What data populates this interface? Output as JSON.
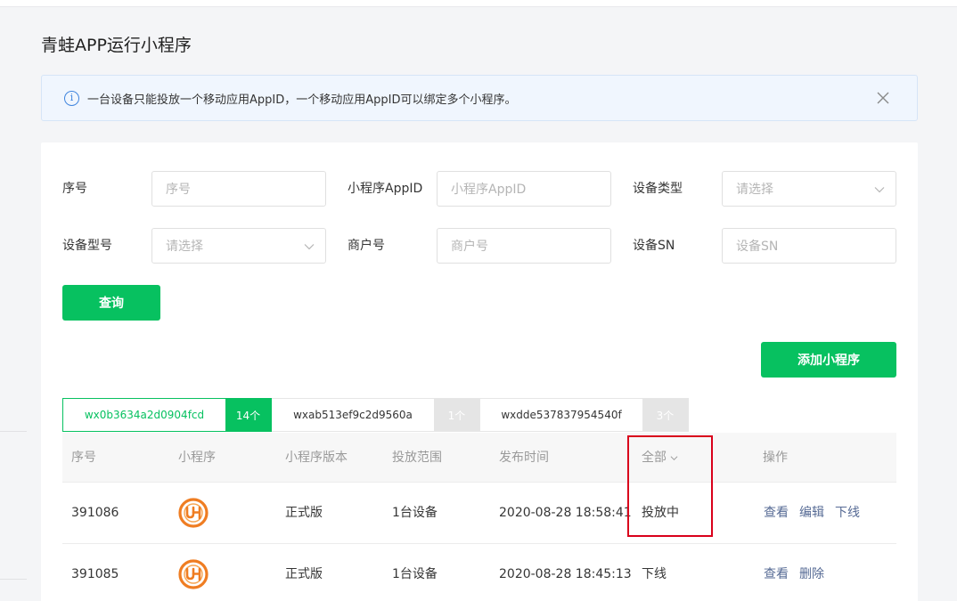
{
  "page": {
    "title": "青蛙APP运行小程序"
  },
  "notice": {
    "text": "一台设备只能投放一个移动应用AppID，一个移动应用AppID可以绑定多个小程序。"
  },
  "filters": {
    "serial": {
      "label": "序号",
      "placeholder": "序号"
    },
    "appid": {
      "label": "小程序AppID",
      "placeholder": "小程序AppID"
    },
    "device_type": {
      "label": "设备类型",
      "placeholder": "请选择"
    },
    "device_model": {
      "label": "设备型号",
      "placeholder": "请选择"
    },
    "merchant": {
      "label": "商户号",
      "placeholder": "商户号"
    },
    "sn": {
      "label": "设备SN",
      "placeholder": "设备SN"
    },
    "query_label": "查询"
  },
  "add_button_label": "添加小程序",
  "tabs": [
    {
      "name": "wx0b3634a2d0904fcd",
      "count": "14个",
      "active": true
    },
    {
      "name": "wxab513ef9c2d9560a",
      "count": "1个",
      "active": false
    },
    {
      "name": "wxdde537837954540f",
      "count": "3个",
      "active": false
    }
  ],
  "table": {
    "headers": {
      "serial": "序号",
      "app": "小程序",
      "version": "小程序版本",
      "scope": "投放范围",
      "time": "发布时间",
      "status": "全部",
      "ops": "操作"
    },
    "rows": [
      {
        "serial": "391086",
        "version": "正式版",
        "scope": "1台设备",
        "time": "2020-08-28 18:58:41",
        "status": "投放中",
        "ops": [
          "查看",
          "编辑",
          "下线"
        ]
      },
      {
        "serial": "391085",
        "version": "正式版",
        "scope": "1台设备",
        "time": "2020-08-28 18:45:13",
        "status": "下线",
        "ops": [
          "查看",
          "删除"
        ]
      }
    ]
  },
  "colors": {
    "brand_green": "#07c160",
    "link": "#576b95",
    "info_blue": "#3f85de",
    "highlight_red": "#d9001b"
  },
  "icons": {
    "notice": "info-icon",
    "close": "close-icon",
    "select": "chevron-down-icon",
    "app_logo": "uh-logo-icon"
  }
}
